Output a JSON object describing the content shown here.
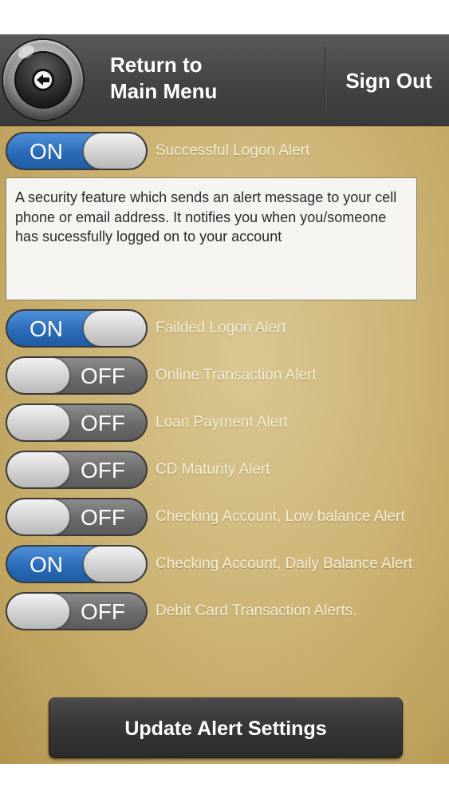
{
  "header": {
    "back_icon": "back-arrow-icon",
    "return_line1": "Return to",
    "return_line2": "Main Menu",
    "sign_out": "Sign Out"
  },
  "colors": {
    "on_toggle": "#2a6cb8",
    "off_toggle": "#6a6a6a",
    "header_bg": "#434343",
    "background": "#cdb577"
  },
  "alerts": [
    {
      "label": "Successful Logon Alert",
      "state": "ON"
    },
    {
      "label": "Failded Logon Alert",
      "state": "ON"
    },
    {
      "label": "Online Transaction Alert",
      "state": "OFF"
    },
    {
      "label": "Loan Payment Alert",
      "state": "OFF"
    },
    {
      "label": "CD Maturity Alert",
      "state": "OFF"
    },
    {
      "label": "Checking Account, Low balance Alert",
      "state": "OFF"
    },
    {
      "label": "Checking Account, Daily Balance Alert",
      "state": "ON"
    },
    {
      "label": "Debit Card Transaction Alerts.",
      "state": "OFF"
    }
  ],
  "description": "A security feature which sends an alert message to your cell phone or email address. It notifies you when you/someone has sucessfully logged on to your account",
  "update_button": "Update Alert Settings"
}
